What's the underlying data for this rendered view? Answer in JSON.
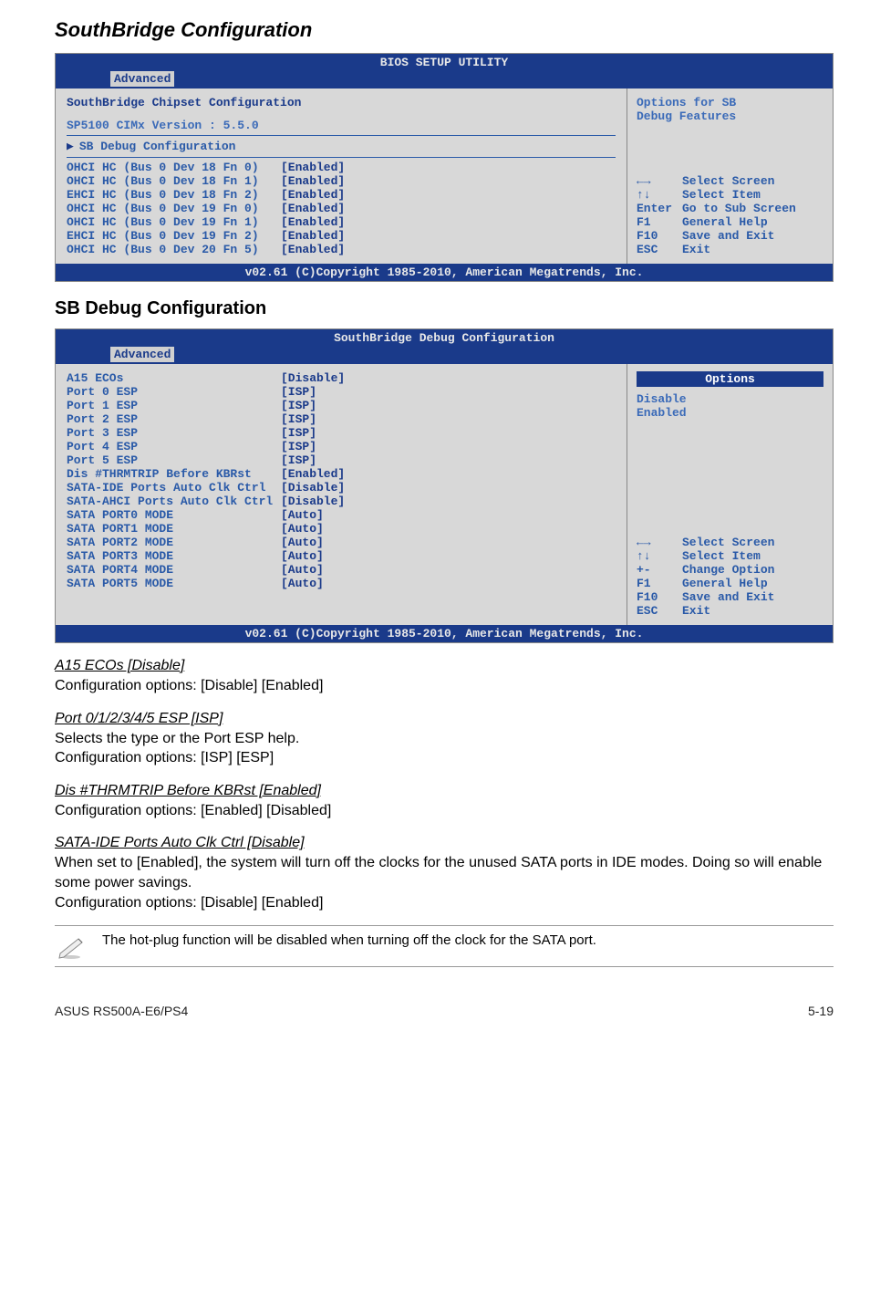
{
  "section_title": "SouthBridge Configuration",
  "bios1": {
    "header_title": "BIOS SETUP UTILITY",
    "tab": "Advanced",
    "left": {
      "heading": "SouthBridge Chipset Configuration",
      "version": "SP5100 CIMx Version : 5.5.0",
      "submenu": "SB Debug Configuration",
      "rows": [
        {
          "label": "OHCI HC (Bus 0 Dev 18 Fn 0)",
          "val": "[Enabled]"
        },
        {
          "label": "OHCI HC (Bus 0 Dev 18 Fn 1)",
          "val": "[Enabled]"
        },
        {
          "label": "EHCI HC (Bus 0 Dev 18 Fn 2)",
          "val": "[Enabled]"
        },
        {
          "label": "OHCI HC (Bus 0 Dev 19 Fn 0)",
          "val": "[Enabled]"
        },
        {
          "label": "OHCI HC (Bus 0 Dev 19 Fn 1)",
          "val": "[Enabled]"
        },
        {
          "label": "EHCI HC (Bus 0 Dev 19 Fn 2)",
          "val": "[Enabled]"
        },
        {
          "label": "OHCI HC (Bus 0 Dev 20 Fn 5)",
          "val": "[Enabled]"
        }
      ]
    },
    "right": {
      "opt_line1": "Options for SB",
      "opt_line2": "Debug Features",
      "keys": [
        {
          "k": "←→",
          "v": "Select Screen"
        },
        {
          "k": "↑↓",
          "v": "Select Item"
        },
        {
          "k": "Enter",
          "v": "Go to Sub Screen"
        },
        {
          "k": "F1",
          "v": "General Help"
        },
        {
          "k": "F10",
          "v": "Save and Exit"
        },
        {
          "k": "ESC",
          "v": "Exit"
        }
      ]
    },
    "footer": "v02.61 (C)Copyright 1985-2010, American Megatrends, Inc."
  },
  "sub_section_title": "SB Debug Configuration",
  "bios2": {
    "header_title": "SouthBridge Debug Configuration",
    "tab": "Advanced",
    "left": {
      "rows": [
        {
          "label": "A15 ECOs",
          "val": "[Disable]"
        },
        {
          "label": "Port 0 ESP",
          "val": "[ISP]"
        },
        {
          "label": "Port 1 ESP",
          "val": "[ISP]"
        },
        {
          "label": "Port 2 ESP",
          "val": "[ISP]"
        },
        {
          "label": "Port 3 ESP",
          "val": "[ISP]"
        },
        {
          "label": "Port 4 ESP",
          "val": "[ISP]"
        },
        {
          "label": "Port 5 ESP",
          "val": "[ISP]"
        },
        {
          "label": "Dis #THRMTRIP Before KBRst",
          "val": "[Enabled]"
        },
        {
          "label": "SATA-IDE Ports Auto Clk Ctrl",
          "val": "[Disable]"
        },
        {
          "label": "SATA-AHCI Ports Auto Clk Ctrl",
          "val": "[Disable]"
        },
        {
          "label": "SATA PORT0 MODE",
          "val": "[Auto]"
        },
        {
          "label": "SATA PORT1 MODE",
          "val": "[Auto]"
        },
        {
          "label": "SATA PORT2 MODE",
          "val": "[Auto]"
        },
        {
          "label": "SATA PORT3 MODE",
          "val": "[Auto]"
        },
        {
          "label": "SATA PORT4 MODE",
          "val": "[Auto]"
        },
        {
          "label": "SATA PORT5 MODE",
          "val": "[Auto]"
        }
      ]
    },
    "right": {
      "options_heading": "Options",
      "opt_line1": "Disable",
      "opt_line2": "Enabled",
      "keys": [
        {
          "k": "←→",
          "v": "Select Screen"
        },
        {
          "k": "↑↓",
          "v": "Select Item"
        },
        {
          "k": "+-",
          "v": "Change Option"
        },
        {
          "k": "F1",
          "v": "General Help"
        },
        {
          "k": "F10",
          "v": "Save and Exit"
        },
        {
          "k": "ESC",
          "v": "Exit"
        }
      ]
    },
    "footer": "v02.61 (C)Copyright 1985-2010, American Megatrends, Inc."
  },
  "descriptions": [
    {
      "title": "A15 ECOs [Disable]",
      "body": "Configuration options: [Disable] [Enabled]"
    },
    {
      "title": "Port 0/1/2/3/4/5 ESP [ISP]",
      "body": "Selects the type or the Port ESP help.\nConfiguration options: [ISP] [ESP]"
    },
    {
      "title": "Dis #THRMTRIP Before KBRst [Enabled]",
      "body": "Configuration options: [Enabled] [Disabled]"
    },
    {
      "title": "SATA-IDE Ports Auto Clk Ctrl [Disable]",
      "body": "When set to [Enabled], the system will turn off the clocks for the unused SATA ports in IDE modes. Doing so will enable some power savings.\nConfiguration options: [Disable] [Enabled]"
    }
  ],
  "note": "The hot-plug function will be disabled when turning off the clock for the SATA port.",
  "footer_left": "ASUS RS500A-E6/PS4",
  "footer_right": "5-19"
}
